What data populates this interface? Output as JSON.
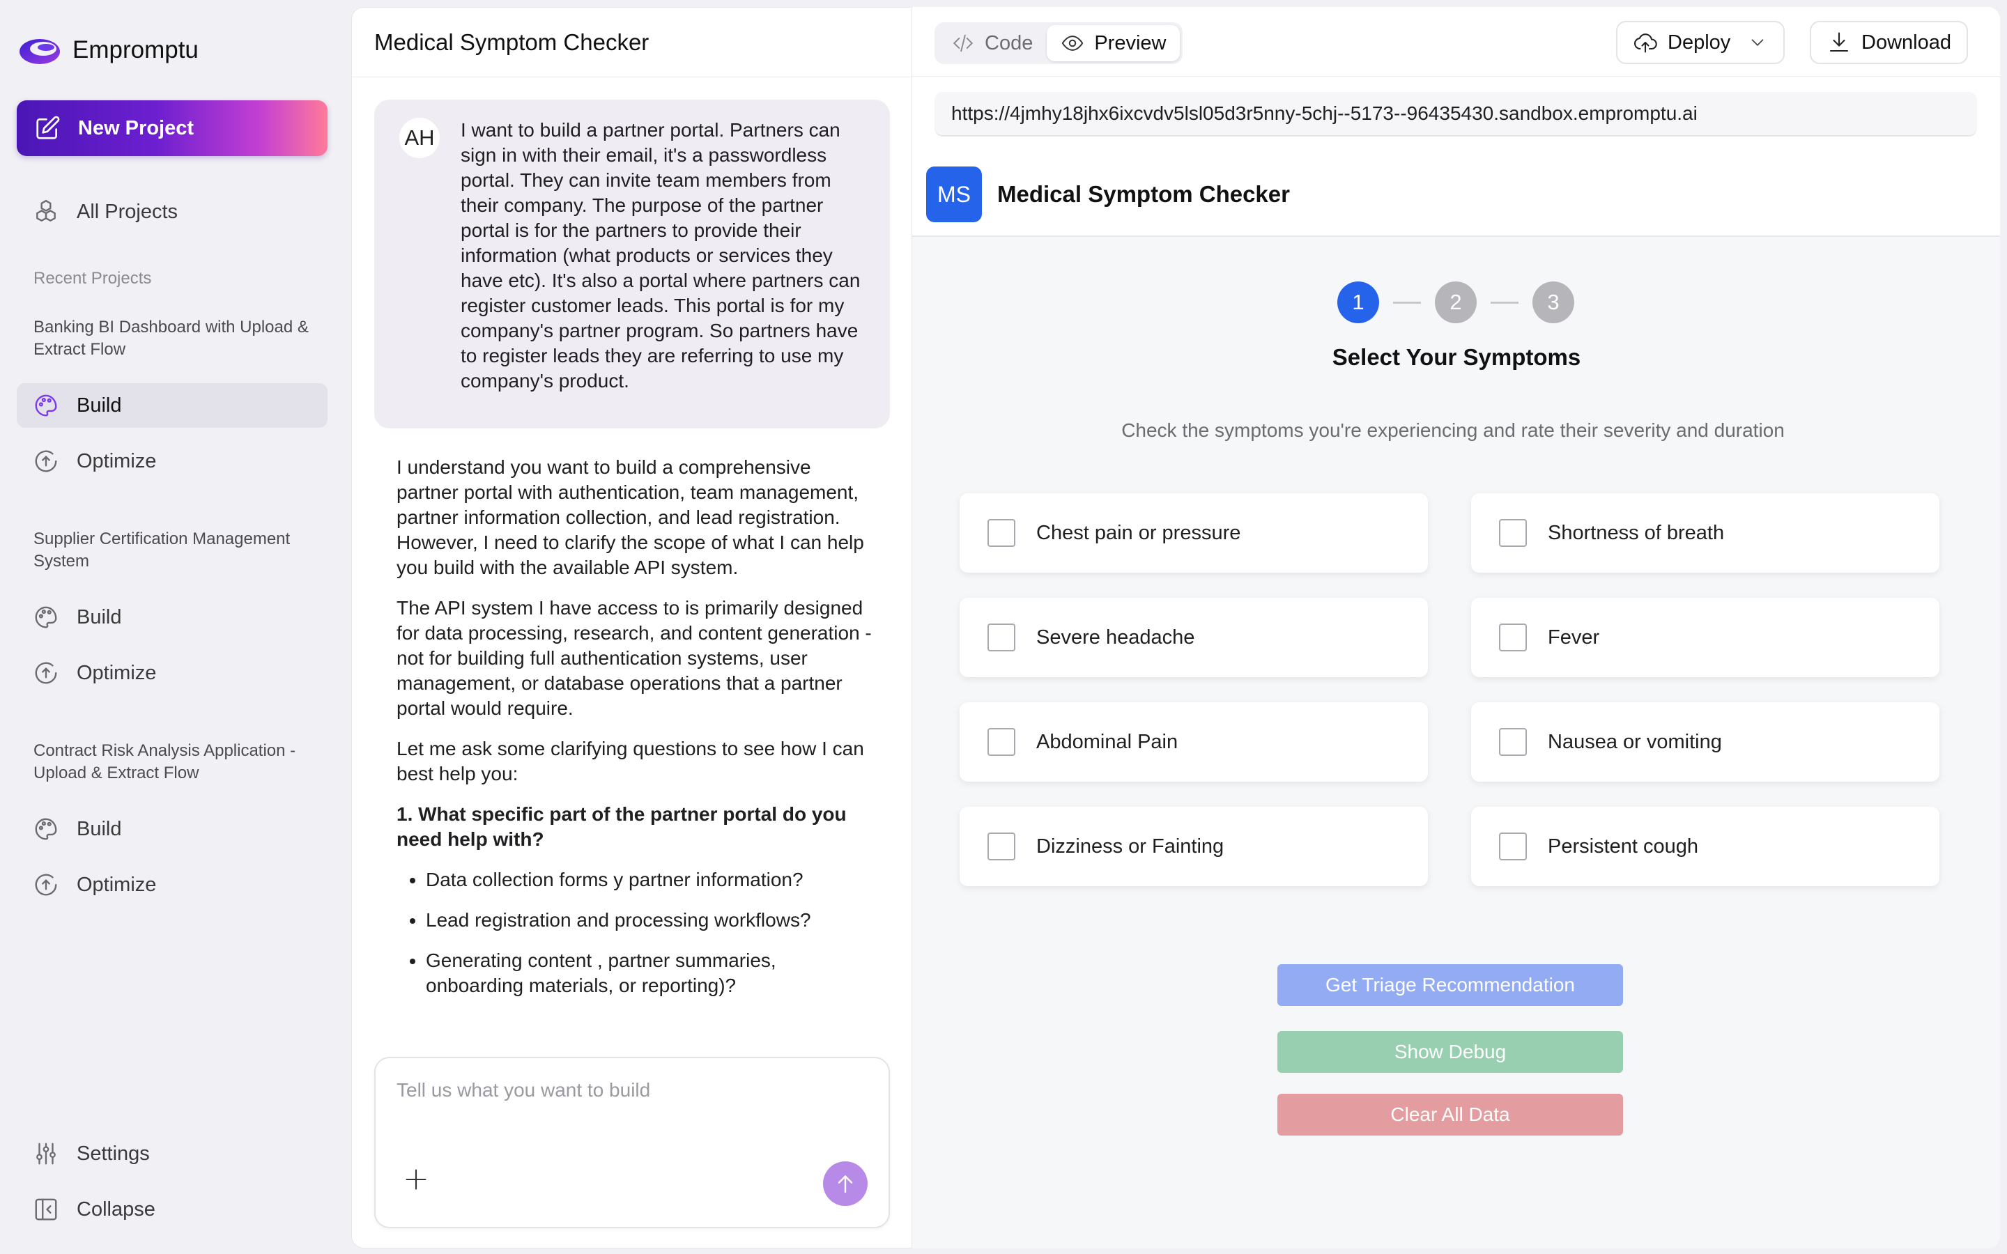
{
  "app": {
    "name": "Empromptu"
  },
  "sidebar": {
    "new_project": "New Project",
    "all_projects": "All Projects",
    "recent_label": "Recent Projects",
    "projects": [
      {
        "title": "Banking BI Dashboard with Upload & Extract Flow",
        "build": "Build",
        "optimize": "Optimize"
      },
      {
        "title": "Supplier Certification Management System",
        "build": "Build",
        "optimize": "Optimize"
      },
      {
        "title": "Contract Risk Analysis Application - Upload & Extract Flow",
        "build": "Build",
        "optimize": "Optimize"
      }
    ],
    "settings": "Settings",
    "collapse": "Collapse"
  },
  "chat": {
    "title": "Medical Symptom Checker",
    "user_initials": "AH",
    "user_message": "I want to build a partner portal. Partners can sign in with their email, it's a passwordless portal. They can invite team members from their company. The purpose of the partner portal is for the partners to provide their information (what products or services they have etc). It's also a portal where partners can register customer leads. This portal is for my company's partner program. So partners have to register leads they are referring to use my company's product.",
    "assistant": {
      "p1": "I understand you want to build a comprehensive partner portal with authentication, team management, partner information collection, and lead registration. However, I need to clarify the scope of what I can help you build with the available API system.",
      "p2": "The API system I have access to is primarily designed for data processing, research, and content generation - not for building full authentication systems, user management, or database operations that a partner portal would require.",
      "p3": "Let me ask some clarifying questions to see how I can best help you:",
      "q1": "1. What specific part of the partner portal do you need help with?",
      "bullets": [
        "Data collection forms y partner information?",
        "Lead registration and processing workflows?",
        "Generating content , partner summaries, onboarding materials, or reporting)?"
      ]
    },
    "input_placeholder": "Tell us what you want to build"
  },
  "preview": {
    "tab_code": "Code",
    "tab_preview": "Preview",
    "deploy": "Deploy",
    "download": "Download",
    "url": "https://4jmhy18jhx6ixcvdv5lsl05d3r5nny-5chj--5173--96435430.sandbox.empromptu.ai",
    "app": {
      "badge": "MS",
      "title": "Medical Symptom Checker",
      "steps": [
        "1",
        "2",
        "3"
      ],
      "active_step": 1,
      "step_title": "Select Your Symptoms",
      "step_subtitle": "Check the symptoms you're experiencing and rate their severity and duration",
      "symptoms": [
        "Chest pain or pressure",
        "Shortness of breath",
        "Severe headache",
        "Fever",
        "Abdominal Pain",
        "Nausea or vomiting",
        "Dizziness or Fainting",
        "Persistent cough"
      ],
      "buttons": {
        "triage": "Get Triage Recommendation",
        "debug": "Show Debug",
        "clear": "Clear All Data"
      },
      "button_colors": {
        "triage": "#93abf3",
        "debug": "#97cfb0",
        "clear": "#e39da0"
      }
    }
  },
  "colors": {
    "accent": "#2563eb",
    "brand_gradient_start": "#4a16b5",
    "brand_gradient_end": "#ff7a9a"
  }
}
